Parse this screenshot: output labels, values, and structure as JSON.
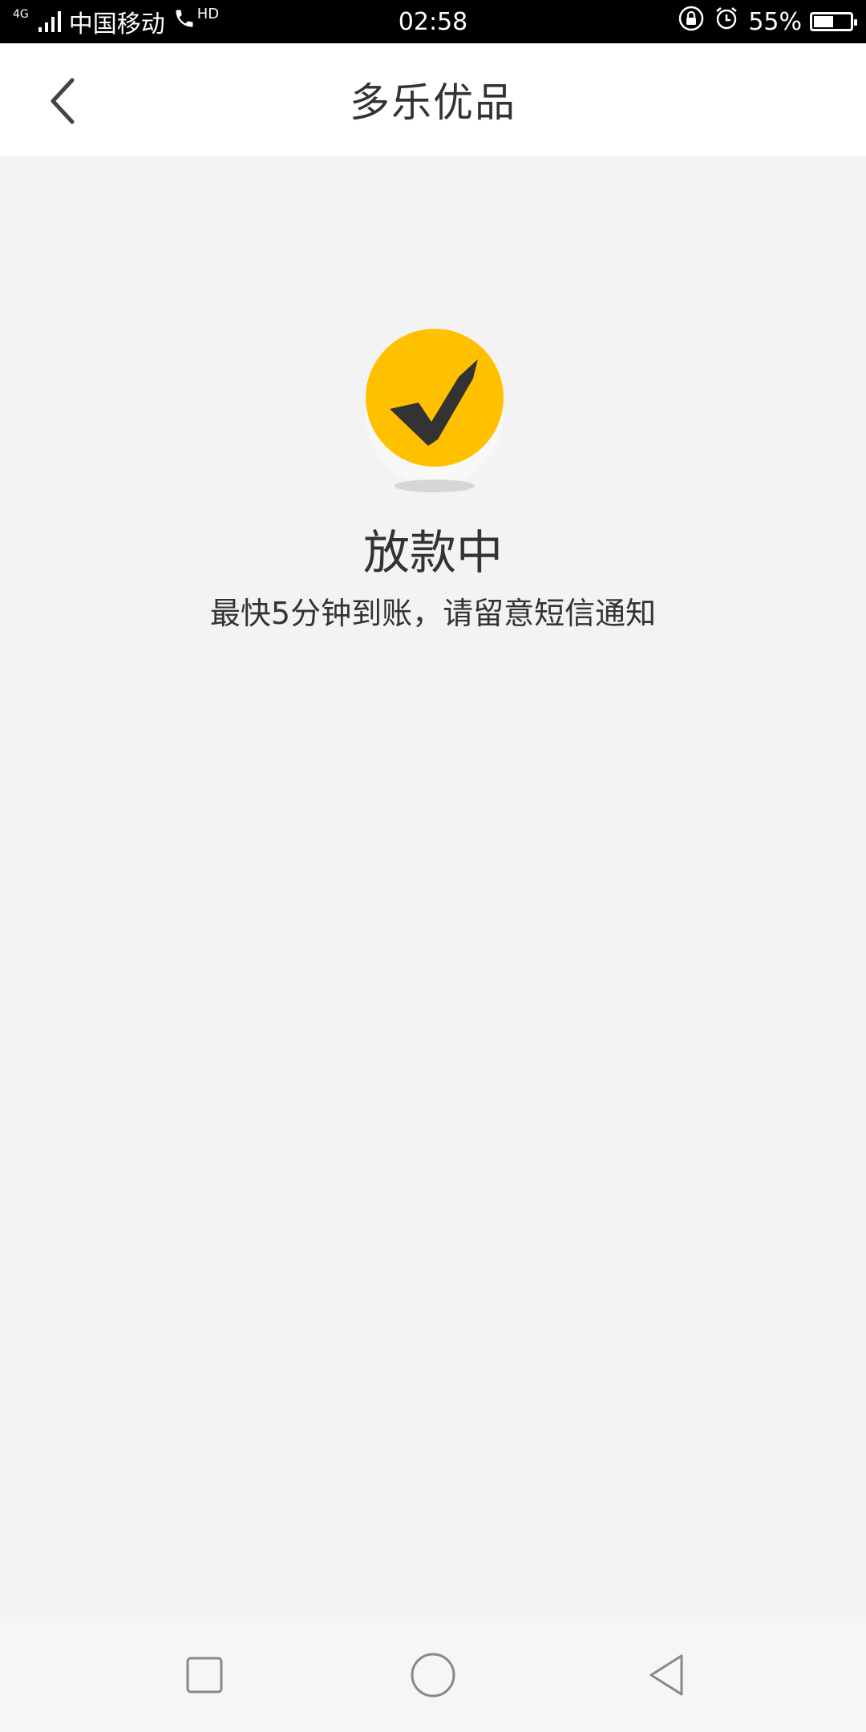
{
  "status_bar": {
    "network_type": "4G",
    "carrier": "中国移动",
    "call_badge": "HD",
    "time": "02:58",
    "battery_percent": "55%",
    "battery_level": 0.55
  },
  "header": {
    "title": "多乐优品"
  },
  "main": {
    "status_title": "放款中",
    "status_description": "最快5分钟到账，请留意短信通知",
    "accent_color": "#FFC000"
  },
  "icons": {
    "back": "chevron-left-icon",
    "success": "check-circle-icon",
    "recent_apps": "square-icon",
    "home": "circle-icon",
    "back_system": "triangle-left-icon"
  }
}
